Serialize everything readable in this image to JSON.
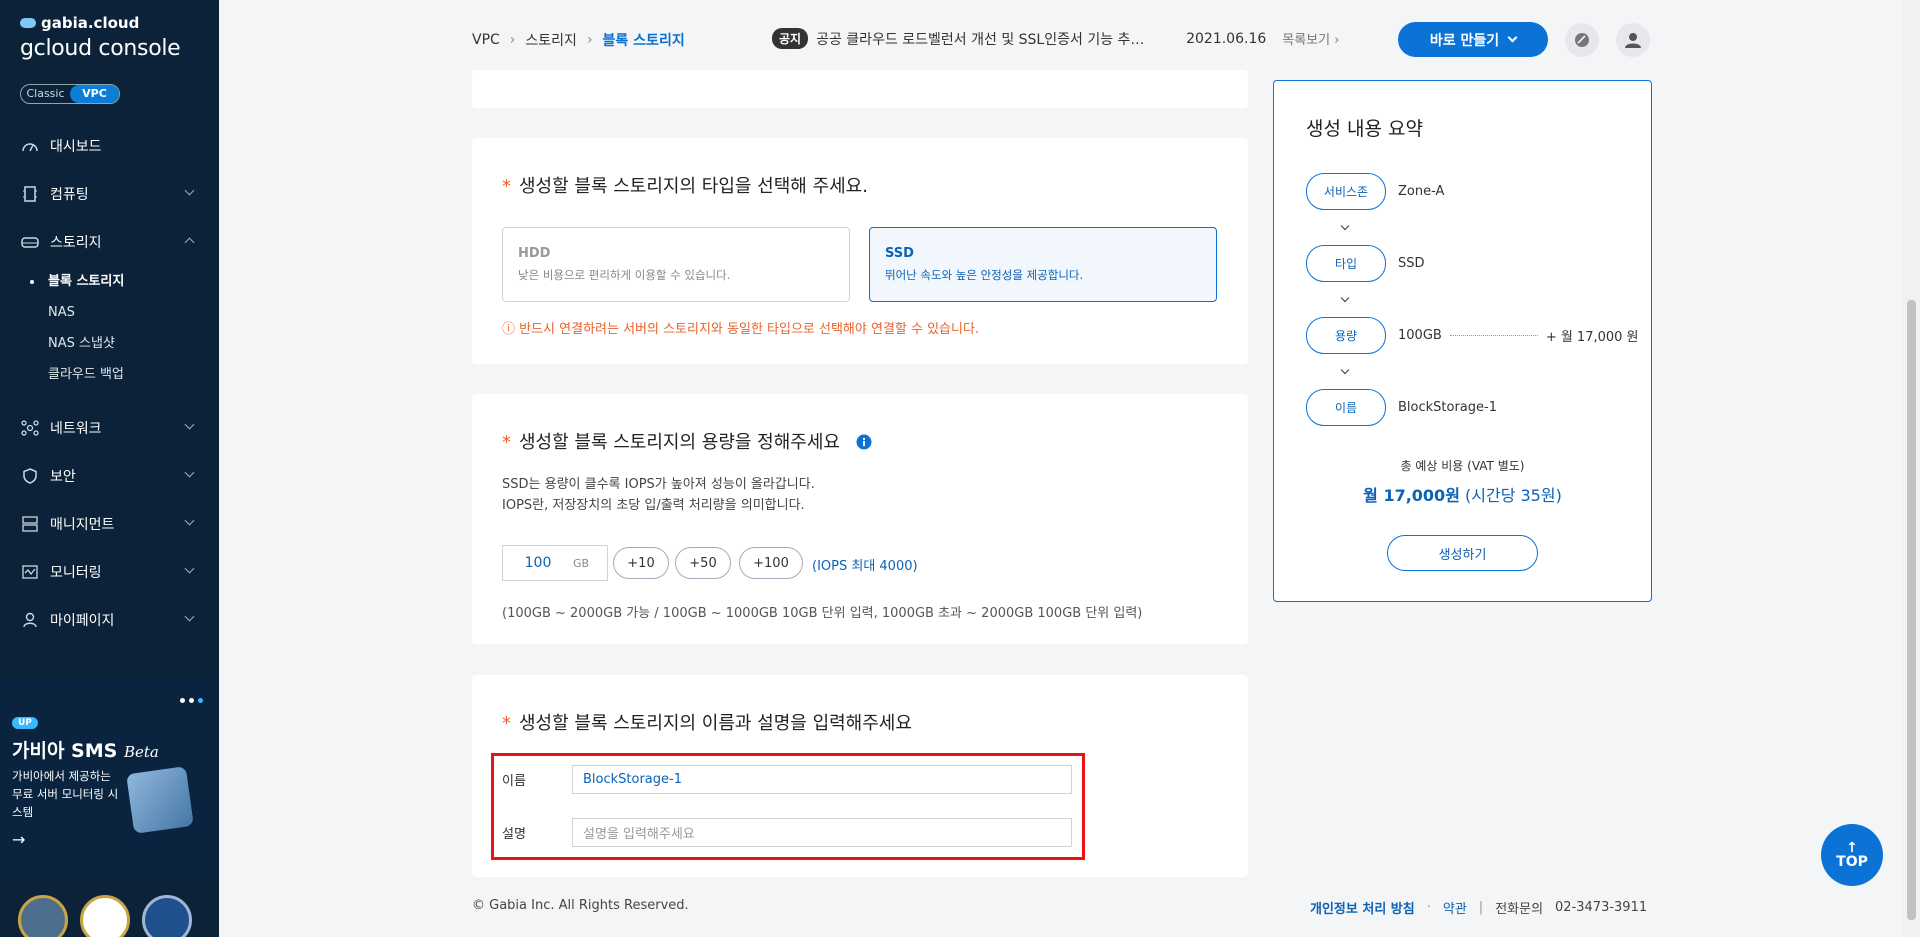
{
  "sidebar": {
    "brand_small": "gabia.cloud",
    "brand_main": "gcloud console",
    "mode": {
      "classic": "Classic",
      "vpc": "VPC"
    },
    "items": [
      {
        "label": "대시보드",
        "icon": "dashboard-icon"
      },
      {
        "label": "컴퓨팅",
        "icon": "compute-icon"
      },
      {
        "label": "스토리지",
        "icon": "storage-icon"
      },
      {
        "label": "네트워크",
        "icon": "network-icon"
      },
      {
        "label": "보안",
        "icon": "shield-icon"
      },
      {
        "label": "매니지먼트",
        "icon": "management-icon"
      },
      {
        "label": "모니터링",
        "icon": "monitor-icon"
      },
      {
        "label": "마이페이지",
        "icon": "user-icon"
      }
    ],
    "storage_sub": [
      "블록 스토리지",
      "NAS",
      "NAS 스냅샷",
      "클라우드 백업"
    ],
    "promo": {
      "badge": "UP",
      "title": "가비아 SMS",
      "title_suffix": "Beta",
      "desc": "가비아에서 제공하는 무료 서버 모니터링 시스템"
    }
  },
  "header": {
    "breadcrumb": [
      "VPC",
      "스토리지",
      "블록 스토리지"
    ],
    "notice_tag": "공지",
    "notice_text": "공공 클라우드 로드벨런서 개선 및 SSL인증서 기능 추…",
    "notice_date": "2021.06.16",
    "notice_more": "목록보기",
    "create_label": "바로 만들기"
  },
  "type_section": {
    "title": "생성할 블록 스토리지의 타입을 선택해 주세요.",
    "options": [
      {
        "name": "HDD",
        "desc": "낮은 비용으로 편리하게 이용할 수 있습니다."
      },
      {
        "name": "SSD",
        "desc": "뛰어난 속도와 높은 안정성을 제공합니다."
      }
    ],
    "selected": "SSD",
    "warning": "ⓘ 반드시 연결하려는 서버의 스토리지와 동일한 타입으로 선택해야 연결할 수 있습니다."
  },
  "capacity_section": {
    "title": "생성할 블록 스토리지의 용량을 정해주세요",
    "desc1": "SSD는 용량이 클수록 IOPS가 높아져 성능이 올라갑니다.",
    "desc2": "IOPS란, 저장장치의 초당 입/출력 처리량을 의미합니다.",
    "value": "100",
    "unit": "GB",
    "buttons": [
      "+10",
      "+50",
      "+100"
    ],
    "iops": "(IOPS 최대 4000)",
    "range": "(100GB ~ 2000GB 가능 / 100GB ~ 1000GB 10GB 단위 입력, 1000GB 초과 ~ 2000GB 100GB 단위 입력)"
  },
  "name_section": {
    "title": "생성할 블록 스토리지의 이름과 설명을 입력해주세요",
    "name_label": "이름",
    "name_value": "BlockStorage-1",
    "desc_label": "설명",
    "desc_placeholder": "설명을 입력해주세요"
  },
  "summary": {
    "title": "생성 내용 요약",
    "rows": [
      {
        "label": "서비스존",
        "value": "Zone-A"
      },
      {
        "label": "타입",
        "value": "SSD"
      },
      {
        "label": "용량",
        "value": "100GB",
        "price": "+ 월 17,000 원"
      },
      {
        "label": "이름",
        "value": "BlockStorage-1"
      }
    ],
    "total_label": "총 예상 비용 (VAT 별도)",
    "total_price": "월 17,000원",
    "total_hourly": "(시간당 35원)",
    "submit_label": "생성하기"
  },
  "footer": {
    "copyright": "© Gabia Inc. All Rights Reserved.",
    "privacy": "개인정보 처리 방침",
    "terms": "약관",
    "contact_label": "전화문의",
    "contact_number": "02-3473-3911"
  },
  "top_button": "TOP",
  "colors": {
    "accent": "#0b72d6",
    "sidebar": "#0b2239",
    "warning": "#e8632b",
    "highlight": "#ee1111"
  }
}
